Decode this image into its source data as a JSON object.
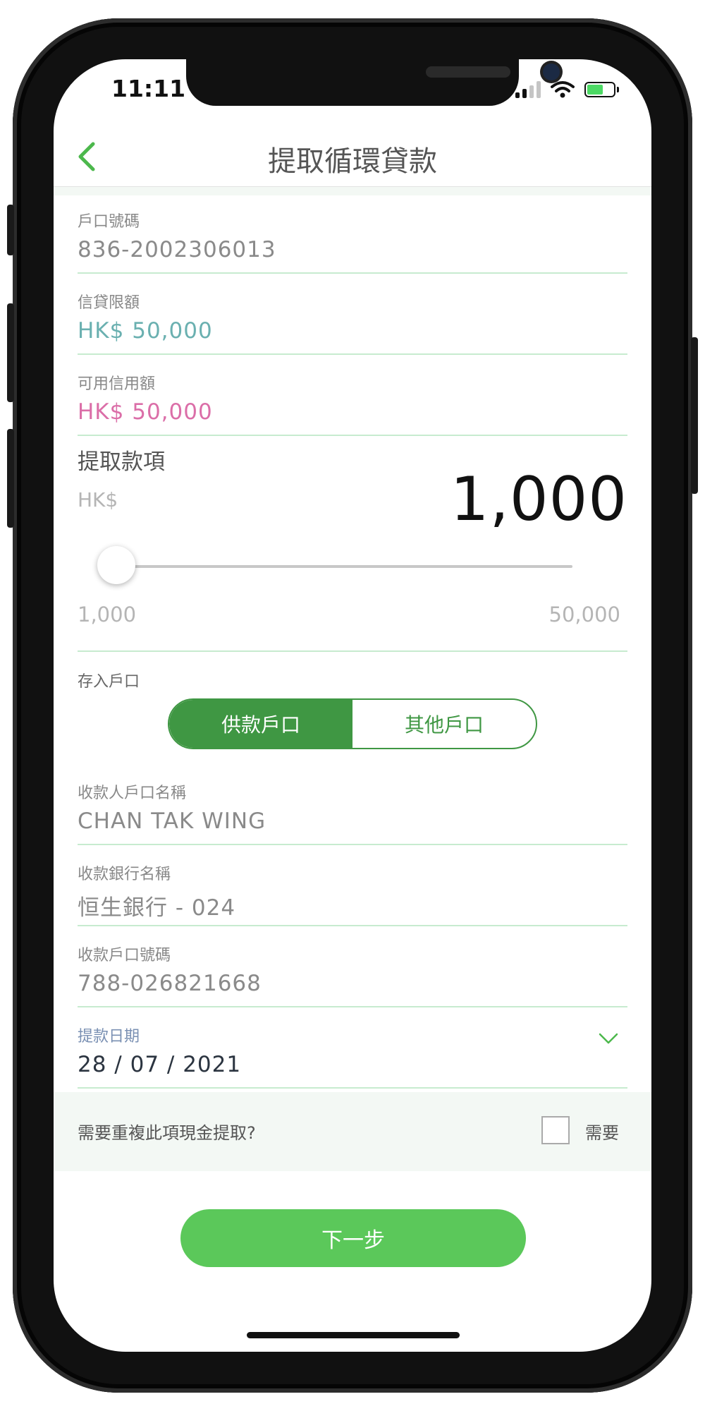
{
  "status_bar": {
    "time": "11:11"
  },
  "header": {
    "title": "提取循環貸款"
  },
  "account": {
    "label": "戶口號碼",
    "value": "836-2002306013"
  },
  "credit_limit": {
    "label": "信貸限額",
    "value": "HK$ 50,000"
  },
  "available_credit": {
    "label": "可用信用額",
    "value": "HK$ 50,000"
  },
  "withdrawal": {
    "label": "提取款項",
    "currency": "HK$",
    "amount": "1,000",
    "slider_min_label": "1,000",
    "slider_max_label": "50,000",
    "slider_fraction": 0.0
  },
  "deposit": {
    "label": "存入戶口",
    "options": [
      "供款戶口",
      "其他戶口"
    ],
    "selected": "供款戶口"
  },
  "payee_name": {
    "label": "收款人戶口名稱",
    "value": "CHAN TAK WING"
  },
  "payee_bank": {
    "label": "收款銀行名稱",
    "value": "恒生銀行 - 024"
  },
  "payee_account": {
    "label": "收款戶口號碼",
    "value": "788-026821668"
  },
  "withdraw_date": {
    "label": "提款日期",
    "value": "28 / 07 / 2021"
  },
  "repeat": {
    "question": "需要重複此項現金提取?",
    "checkbox_label": "需要",
    "checked": false
  },
  "next_button": {
    "label": "下一步"
  },
  "colors": {
    "primary_green": "#3f9743",
    "button_green": "#5bc85a",
    "back_green": "#4cb84c",
    "teal_value": "#6ab0b0",
    "pink_value": "#db6ea8",
    "divider": "#c7ebcf"
  },
  "icons": {
    "back": "chevron-left-icon",
    "dropdown": "chevron-down-icon",
    "signal": "cellular-signal-icon",
    "wifi": "wifi-icon",
    "battery": "battery-charging-icon"
  }
}
